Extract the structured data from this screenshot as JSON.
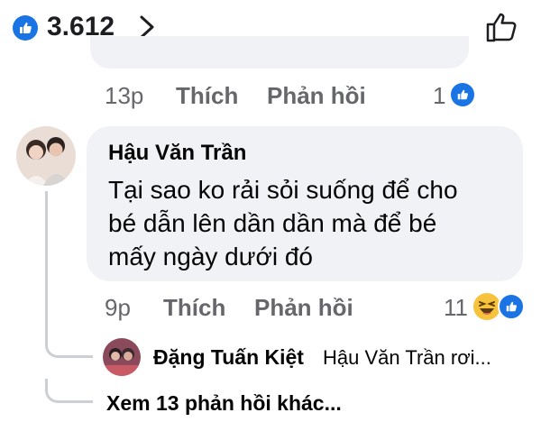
{
  "header": {
    "reaction_count": "3.612",
    "colors": {
      "like_blue": "#1b74e4",
      "meta_grey": "#65676b",
      "bubble_bg": "#f0f2f5"
    }
  },
  "prev_comment": {
    "time": "13p",
    "like_label": "Thích",
    "reply_label": "Phản hồi",
    "reaction_count": "1"
  },
  "comment": {
    "author": "Hậu Văn Trần",
    "text_lines": [
      "Tại sao ko rải sỏi suống để cho",
      "bé dẫn lên dần dần mà để bé",
      "mấy ngày dưới đó"
    ],
    "time": "9p",
    "like_label": "Thích",
    "reply_label": "Phản hồi",
    "reaction_count": "11",
    "reactions": [
      "haha-icon",
      "like-icon"
    ]
  },
  "reply": {
    "author": "Đặng Tuấn Kiệt",
    "preview": "Hậu Văn Trần rơi..."
  },
  "more_replies": "Xem 13 phản hồi khác..."
}
